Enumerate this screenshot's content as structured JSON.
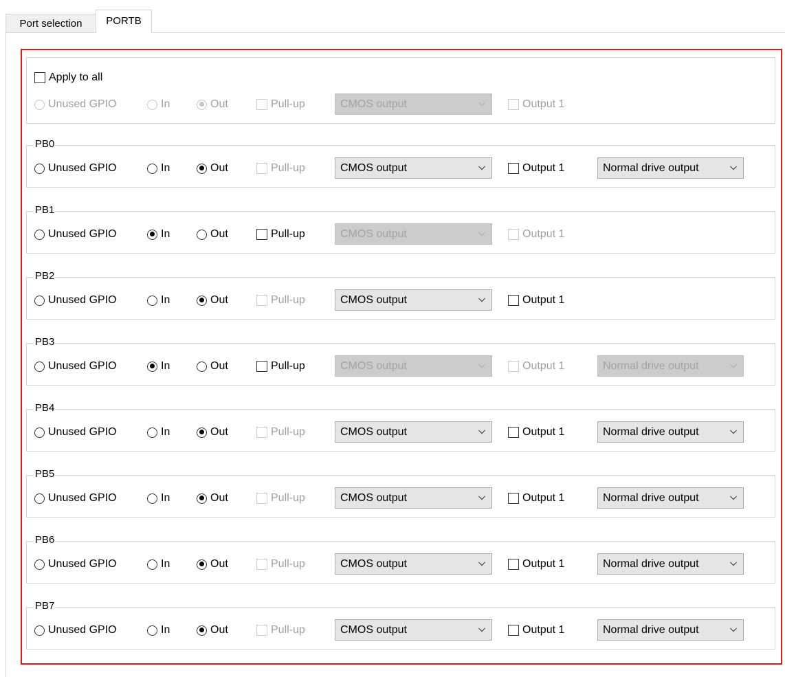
{
  "tabs": [
    {
      "label": "Port selection",
      "active": false
    },
    {
      "label": "PORTB",
      "active": true
    }
  ],
  "apply_all": {
    "label": "Apply to all",
    "checked": false,
    "unused_label": "Unused GPIO",
    "in_label": "In",
    "out_label": "Out",
    "pullup_label": "Pull-up",
    "output_type": "CMOS output",
    "output1_label": "Output 1"
  },
  "pins": [
    {
      "name": "PB0",
      "mode": "Out",
      "pullup": false,
      "output_type": "CMOS output",
      "output1": false,
      "drive": "Normal drive output"
    },
    {
      "name": "PB1",
      "mode": "In",
      "pullup": false,
      "output_type": "CMOS output",
      "output1": false,
      "drive": null
    },
    {
      "name": "PB2",
      "mode": "Out",
      "pullup": false,
      "output_type": "CMOS output",
      "output1": false,
      "drive": null
    },
    {
      "name": "PB3",
      "mode": "In",
      "pullup": false,
      "output_type": "CMOS output",
      "output1": false,
      "drive": "Normal drive output"
    },
    {
      "name": "PB4",
      "mode": "Out",
      "pullup": false,
      "output_type": "CMOS output",
      "output1": false,
      "drive": "Normal drive output"
    },
    {
      "name": "PB5",
      "mode": "Out",
      "pullup": false,
      "output_type": "CMOS output",
      "output1": false,
      "drive": "Normal drive output"
    },
    {
      "name": "PB6",
      "mode": "Out",
      "pullup": false,
      "output_type": "CMOS output",
      "output1": false,
      "drive": "Normal drive output"
    },
    {
      "name": "PB7",
      "mode": "Out",
      "pullup": false,
      "output_type": "CMOS output",
      "output1": false,
      "drive": "Normal drive output"
    }
  ],
  "labels": {
    "unused": "Unused GPIO",
    "in": "In",
    "out": "Out",
    "pullup": "Pull-up",
    "output1": "Output 1"
  },
  "colors": {
    "highlight_border": "#e8161b",
    "disabled_text": "#a0a0a0",
    "select_bg": "#e5e5e5",
    "select_disabled_bg": "#cccccc"
  }
}
